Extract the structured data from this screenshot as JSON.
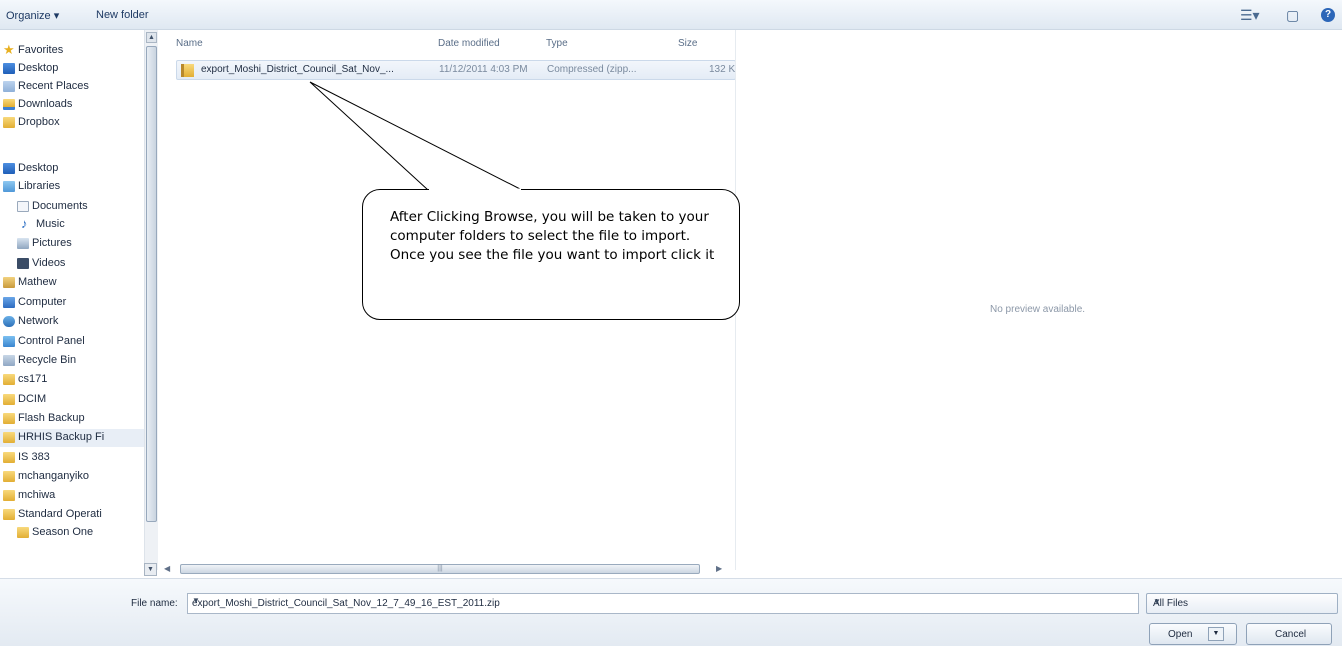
{
  "toolbar": {
    "organize_label": "Organize ▾",
    "new_folder_label": "New folder",
    "view_icon": "view-options-icon",
    "pane_icon": "preview-pane-icon",
    "help_icon": "help-icon",
    "help_glyph": "?"
  },
  "nav": {
    "items": [
      {
        "label": "Favorites",
        "icon": "star"
      },
      {
        "label": "Desktop",
        "icon": "desktop"
      },
      {
        "label": "Recent Places",
        "icon": "recent"
      },
      {
        "label": "Downloads",
        "icon": "download"
      },
      {
        "label": "Dropbox",
        "icon": "folder"
      },
      {
        "label": "Desktop",
        "icon": "desktop"
      },
      {
        "label": "Libraries",
        "icon": "lib"
      },
      {
        "label": "Documents",
        "icon": "doc"
      },
      {
        "label": "Music",
        "icon": "music"
      },
      {
        "label": "Pictures",
        "icon": "pic"
      },
      {
        "label": "Videos",
        "icon": "video"
      },
      {
        "label": "Mathew",
        "icon": "user"
      },
      {
        "label": "Computer",
        "icon": "computer"
      },
      {
        "label": "Network",
        "icon": "network"
      },
      {
        "label": "Control Panel",
        "icon": "cpanel"
      },
      {
        "label": "Recycle Bin",
        "icon": "recycle"
      },
      {
        "label": "cs171",
        "icon": "folder"
      },
      {
        "label": "DCIM",
        "icon": "folder"
      },
      {
        "label": "Flash Backup",
        "icon": "folder"
      },
      {
        "label": "HRHIS Backup Fi",
        "icon": "folder"
      },
      {
        "label": "IS 383",
        "icon": "folder"
      },
      {
        "label": "mchanganyiko",
        "icon": "folder"
      },
      {
        "label": "mchiwa",
        "icon": "folder"
      },
      {
        "label": "Standard Operati",
        "icon": "folder"
      },
      {
        "label": "Season One",
        "icon": "folder"
      }
    ]
  },
  "list": {
    "columns": {
      "name": "Name",
      "date": "Date modified",
      "type": "Type",
      "size": "Size"
    },
    "files": [
      {
        "name": "export_Moshi_District_Council_Sat_Nov_...",
        "date": "11/12/2011 4:03 PM",
        "type": "Compressed (zipp...",
        "size": "132 K"
      }
    ]
  },
  "preview": {
    "text": "No preview available."
  },
  "callout": {
    "text": "After Clicking Browse, you will be taken to your computer folders to select the file to import. Once you see the file you want to import click it"
  },
  "bottom": {
    "file_name_label": "File name:",
    "file_name_value": "export_Moshi_District_Council_Sat_Nov_12_7_49_16_EST_2011.zip",
    "filter_value": "All Files",
    "open_label": "Open",
    "cancel_label": "Cancel"
  }
}
